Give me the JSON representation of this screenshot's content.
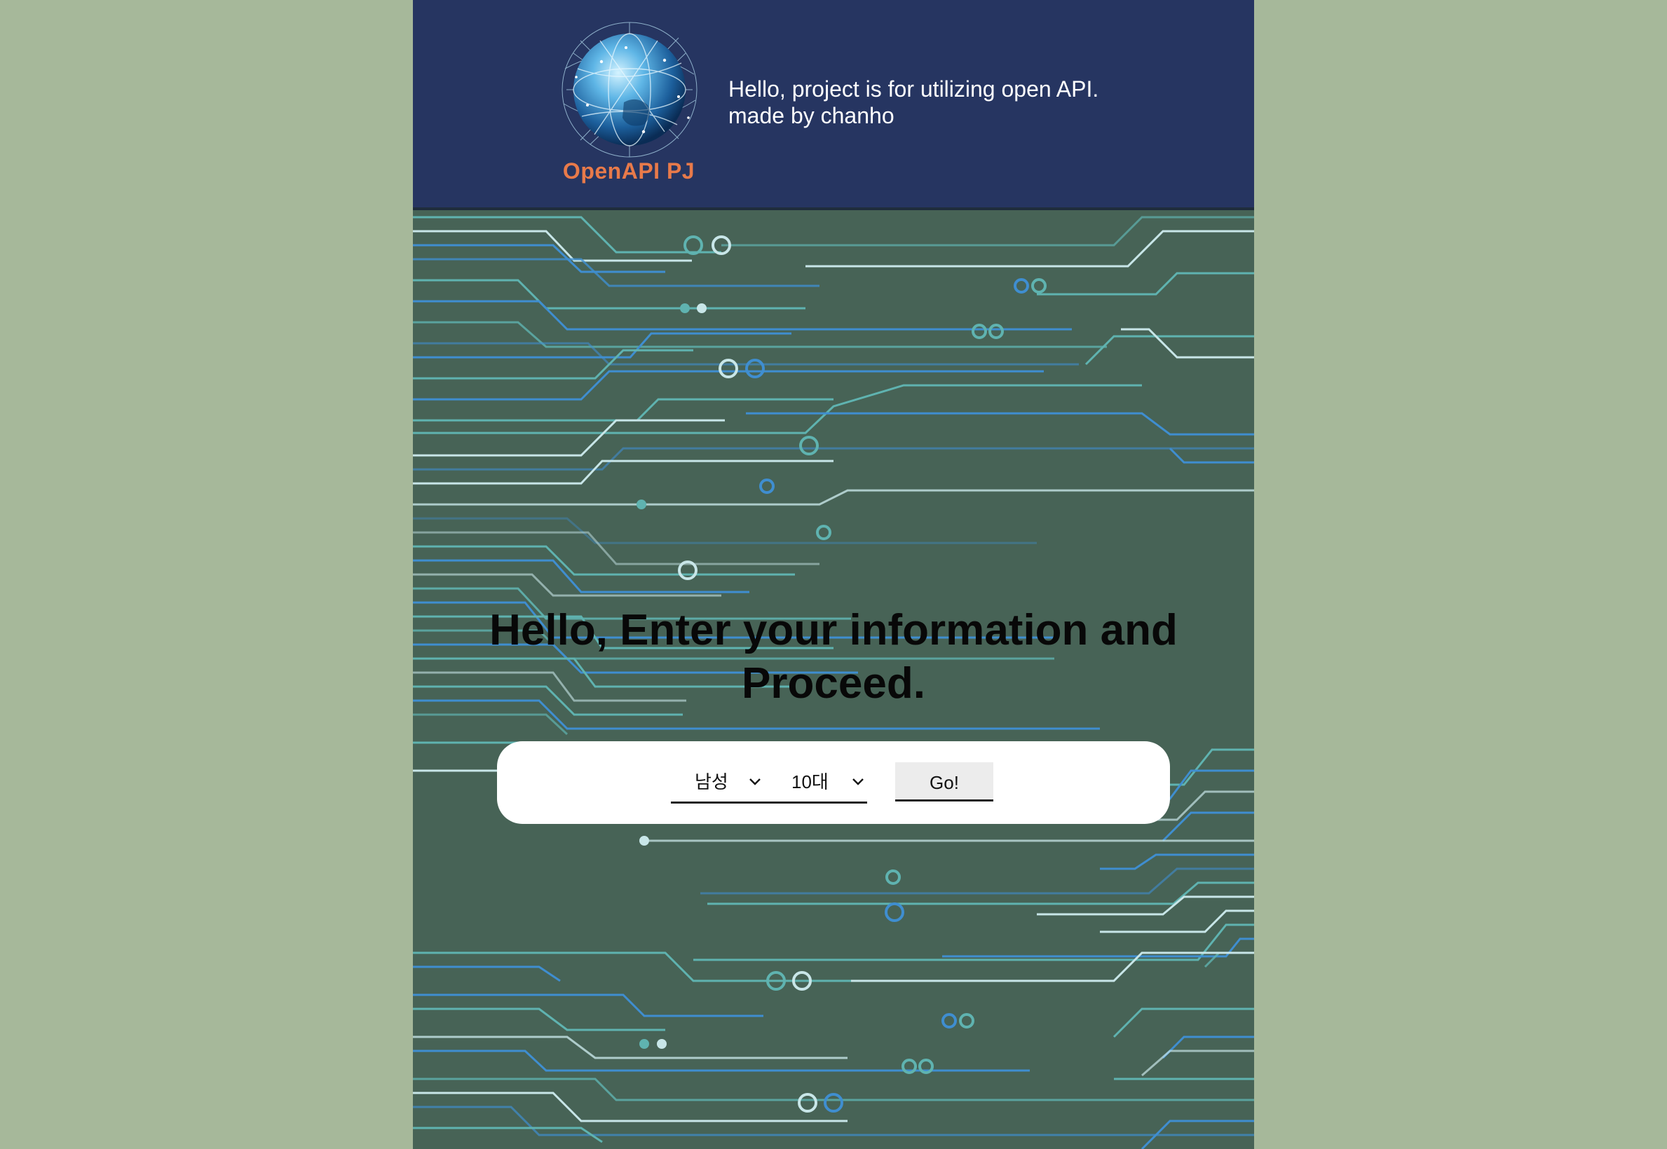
{
  "header": {
    "logo_text": "OpenAPI PJ",
    "intro_line1": "Hello, project is for utilizing open API.",
    "intro_line2": "made by chanho"
  },
  "main": {
    "headline_line1": "Hello, Enter your information and",
    "headline_line2": "Proceed."
  },
  "form": {
    "gender_value": "남성",
    "age_value": "10대",
    "submit_label": "Go!"
  },
  "colors": {
    "outer_background": "#a6b89a",
    "header_background": "#263561",
    "main_background": "#476356",
    "logo_text": "#e87a4a",
    "circuit_teal": "#5fb3b0",
    "circuit_blue": "#3f8ed0",
    "circuit_light": "#c8e6e8"
  },
  "icons": {
    "logo": "globe-network-icon",
    "select_arrow": "chevron-down-icon"
  }
}
